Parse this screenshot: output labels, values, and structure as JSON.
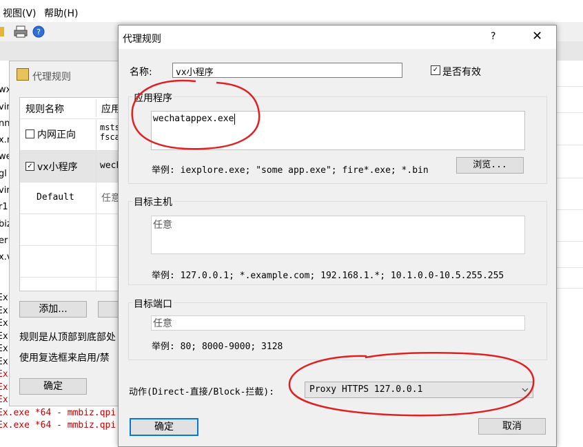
{
  "background_app": {
    "menu": [
      "视图(V)",
      "帮助(H)"
    ],
    "left_edge_text": [
      "wx",
      "vir",
      "nn",
      "x.m",
      "we",
      "gl",
      "vir",
      "r1",
      "biz",
      "er",
      "x.v"
    ],
    "log_lines": [
      "Ex",
      "Ex",
      "Ex",
      "Ex",
      "Ex",
      "Ex",
      "Ex",
      "Ex",
      "Ex.exe *64 - mmbiz.qpi",
      "Ex.exe *64 - mmbiz.qpi",
      "Ex.exe *64 - mmbiz.qpi"
    ]
  },
  "rules_dialog": {
    "title": "代理规则",
    "columns": [
      "规则名称",
      "应用"
    ],
    "rows": [
      {
        "name": "内网正向",
        "app": "msts\nfsca",
        "checked": false
      },
      {
        "name": "vx小程序",
        "app": "wech",
        "checked": true
      },
      {
        "name": "Default",
        "app": "任意",
        "checked": null
      }
    ],
    "add_button": "添加...",
    "note1": "规则是从顶部到底部处",
    "note2": "使用复选框来启用/禁",
    "ok_button": "确定"
  },
  "edit_dialog": {
    "title": "代理规则",
    "help": "?",
    "close": "✕",
    "name_label": "名称:",
    "name_value": "vx小程序",
    "enabled_label": "是否有效",
    "enabled_checked": true,
    "app_group": "应用程序",
    "app_value": "wechatappex.exe",
    "app_hint": "举例: iexplore.exe; \"some app.exe\"; fire*.exe; *.bin",
    "browse_button": "浏览...",
    "host_group": "目标主机",
    "host_value": "任意",
    "host_hint": "举例: 127.0.0.1; *.example.com; 192.168.1.*; 10.1.0.0-10.5.255.255",
    "port_group": "目标端口",
    "port_value": "任意",
    "port_hint": "举例: 80; 8000-9000; 3128",
    "action_label": "动作(Direct-直接/Block-拦截):",
    "action_value": "Proxy HTTPS 127.0.0.1",
    "ok_button": "确定",
    "cancel_button": "取消"
  },
  "colors": {
    "annotation_red": "#e02020",
    "log_red": "#c00000"
  }
}
